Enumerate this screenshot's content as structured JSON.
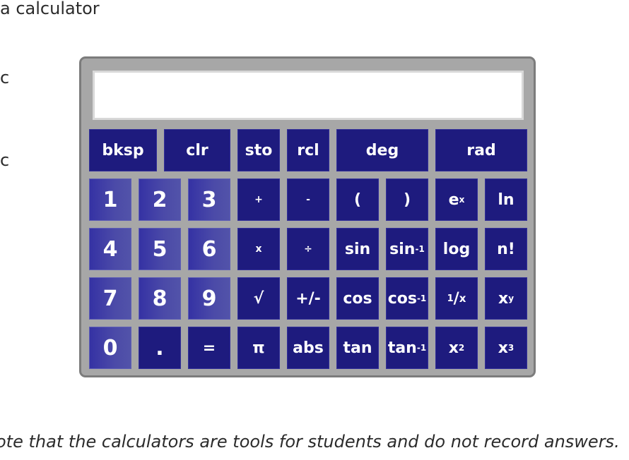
{
  "page": {
    "heading": "a calculator",
    "side_label_1": "c",
    "side_label_2": "c",
    "note": "ote that the calculators are tools for students and do not record answers."
  },
  "calculator": {
    "display_value": "",
    "keys": {
      "bksp": "bksp",
      "clr": "clr",
      "sto": "sto",
      "rcl": "rcl",
      "deg": "deg",
      "rad": "rad",
      "one": "1",
      "two": "2",
      "three": "3",
      "plus": "+",
      "minus": "-",
      "lparen": "(",
      "rparen": ")",
      "exp_base": "e",
      "exp_sup": "x",
      "ln": "ln",
      "four": "4",
      "five": "5",
      "six": "6",
      "times": "x",
      "divide": "÷",
      "sin": "sin",
      "asin_base": "sin",
      "asin_sup": "-1",
      "log": "log",
      "factorial": "n!",
      "seven": "7",
      "eight": "8",
      "nine": "9",
      "sqrt": "√",
      "plusminus": "+/-",
      "cos": "cos",
      "acos_base": "cos",
      "acos_sup": "-1",
      "recip_num": "1",
      "recip_slash": "/",
      "recip_den": "x",
      "pow_base": "x",
      "pow_sup": "y",
      "zero": "0",
      "decimal": ".",
      "equals": "=",
      "pi": "π",
      "abs": "abs",
      "tan": "tan",
      "atan_base": "tan",
      "atan_sup": "-1",
      "sq_base": "x",
      "sq_sup": "2",
      "cube_base": "x",
      "cube_sup": "3"
    }
  }
}
